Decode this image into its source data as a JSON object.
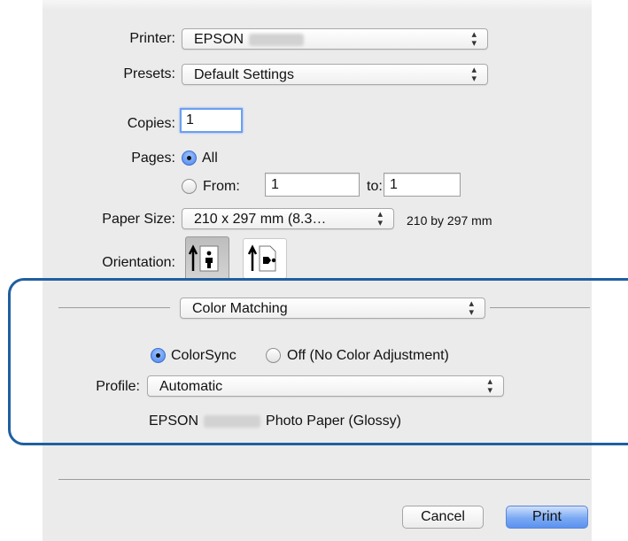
{
  "printer": {
    "label": "Printer:",
    "value": "EPSON"
  },
  "presets": {
    "label": "Presets:",
    "value": "Default Settings"
  },
  "copies": {
    "label": "Copies:",
    "value": "1"
  },
  "pages": {
    "label": "Pages:",
    "all_label": "All",
    "from_label": "From:",
    "from_value": "1",
    "to_label": "to:",
    "to_value": "1",
    "selected": "All"
  },
  "paper_size": {
    "label": "Paper Size:",
    "value": "210 x 297 mm (8.3…",
    "dimensions": "210 by 297 mm"
  },
  "orientation": {
    "label": "Orientation:",
    "selected": "portrait",
    "options": [
      "portrait-icon",
      "landscape-icon"
    ]
  },
  "section": {
    "value": "Color Matching"
  },
  "color_matching": {
    "colorsync_label": "ColorSync",
    "off_label": "Off (No Color Adjustment)",
    "selected": "ColorSync",
    "profile_label": "Profile:",
    "profile_value": "Automatic",
    "profile_desc_prefix": "EPSON",
    "profile_desc_suffix": "Photo Paper (Glossy)"
  },
  "buttons": {
    "cancel": "Cancel",
    "print": "Print"
  },
  "colors": {
    "highlight_border": "#1f5fa0",
    "default_button": "#5b92ef",
    "dialog_bg": "#ebebeb"
  }
}
